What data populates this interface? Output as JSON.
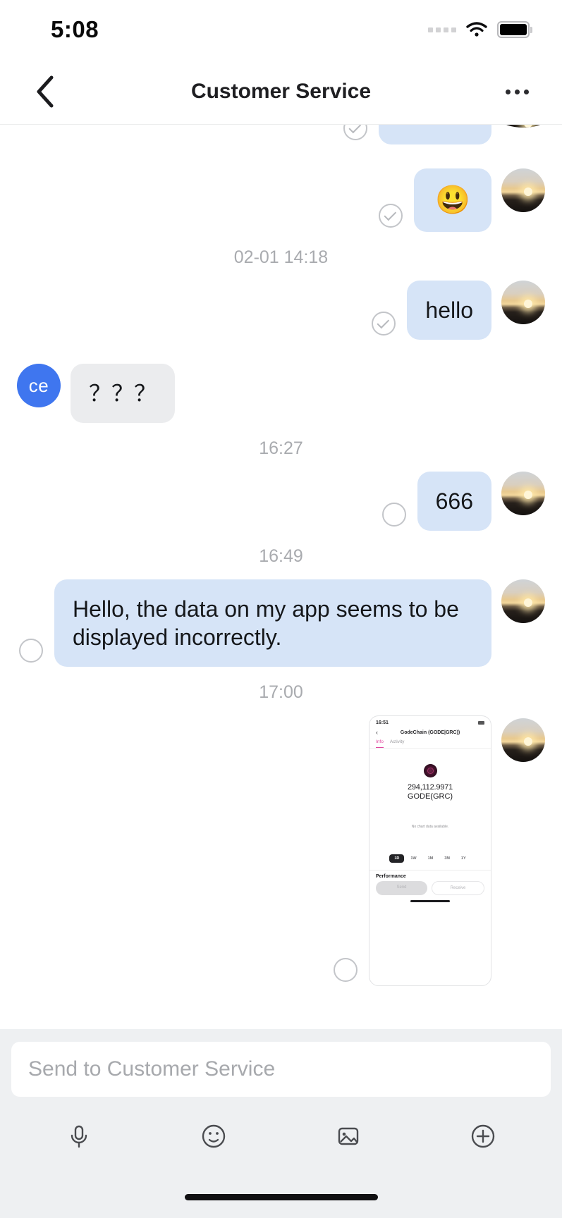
{
  "status_bar": {
    "time": "5:08",
    "signal_icon": "signal-dots-icon",
    "wifi_icon": "wifi-icon",
    "battery_icon": "battery-full-icon"
  },
  "header": {
    "back_icon": "chevron-left-icon",
    "title": "Customer Service",
    "more_icon": "more-horizontal-icon"
  },
  "conversation": {
    "messages": [
      {
        "id": "m0",
        "direction": "out",
        "kind": "partial",
        "text": "",
        "status": "sent",
        "status_label": "check-circle-icon"
      },
      {
        "id": "m1",
        "direction": "out",
        "kind": "emoji",
        "text": "😃",
        "status": "sent",
        "status_label": "check-circle-icon"
      },
      {
        "id": "d1",
        "kind": "divider",
        "text": "02-01 14:18"
      },
      {
        "id": "m2",
        "direction": "out",
        "kind": "text",
        "text": "hello",
        "status": "sent",
        "status_label": "check-circle-icon"
      },
      {
        "id": "m3",
        "direction": "in",
        "kind": "text",
        "text": "？？？",
        "avatar_initials": "ce"
      },
      {
        "id": "d2",
        "kind": "divider",
        "text": "16:27"
      },
      {
        "id": "m4",
        "direction": "out",
        "kind": "text",
        "text": "666",
        "status": "pending",
        "status_label": "pending-circle-icon"
      },
      {
        "id": "d3",
        "kind": "divider",
        "text": "16:49"
      },
      {
        "id": "m5",
        "direction": "out",
        "kind": "text",
        "text": "Hello, the data on my app seems to be displayed incorrectly.",
        "status": "pending",
        "status_label": "pending-circle-icon"
      },
      {
        "id": "d4",
        "kind": "divider",
        "text": "17:00"
      },
      {
        "id": "m6",
        "direction": "out",
        "kind": "screenshot",
        "status": "pending",
        "status_label": "pending-circle-icon"
      }
    ]
  },
  "embedded_screenshot": {
    "status_time": "16:51",
    "back_icon": "chevron-left-icon",
    "title": "GodeChain (GODE|GRC))",
    "tabs": [
      {
        "label": "Info",
        "active": true
      },
      {
        "label": "Activity",
        "active": false
      }
    ],
    "token_logo": "gode-token-icon",
    "balance": "294,112.9971",
    "symbol": "GODE(GRC)",
    "chart_empty_text": "No chart data available.",
    "ranges": [
      {
        "label": "1D",
        "active": true
      },
      {
        "label": "1W",
        "active": false
      },
      {
        "label": "1M",
        "active": false
      },
      {
        "label": "3M",
        "active": false
      },
      {
        "label": "1Y",
        "active": false
      }
    ],
    "performance_heading": "Performance",
    "actions": [
      {
        "label": "Send",
        "style": "primary"
      },
      {
        "label": "Receive",
        "style": "ghost"
      }
    ]
  },
  "composer": {
    "placeholder": "Send to Customer Service",
    "value": "",
    "tools": [
      {
        "name": "microphone-icon",
        "label": "Voice"
      },
      {
        "name": "emoji-icon",
        "label": "Emoji"
      },
      {
        "name": "image-icon",
        "label": "Photo"
      },
      {
        "name": "plus-icon",
        "label": "More"
      }
    ]
  },
  "colors": {
    "outgoing_bubble": "#d6e4f7",
    "incoming_bubble": "#ebecee",
    "avatar_blue": "#3f76ef",
    "accent_pink": "#e0479e",
    "composer_bg": "#eef0f2"
  }
}
